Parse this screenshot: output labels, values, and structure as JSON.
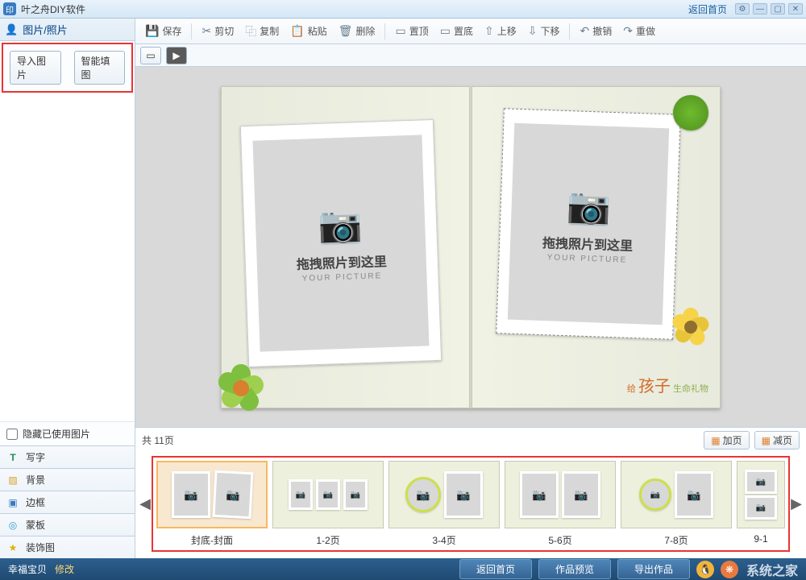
{
  "titlebar": {
    "title": "叶之舟DIY软件",
    "home_link": "返回首页"
  },
  "sidebar": {
    "header": "图片/照片",
    "import_btn": "导入图片",
    "smart_fill_btn": "智能填图",
    "hide_used_label": "隐藏已使用图片",
    "items": [
      {
        "label": "写字",
        "icon": "T",
        "color": "#1a8f5a"
      },
      {
        "label": "背景",
        "icon": "▨",
        "color": "#d9a22b"
      },
      {
        "label": "边框",
        "icon": "▣",
        "color": "#3a7ac0"
      },
      {
        "label": "蒙板",
        "icon": "◎",
        "color": "#2a9dcf"
      },
      {
        "label": "装饰图",
        "icon": "★",
        "color": "#e6b000"
      }
    ]
  },
  "toolbar": {
    "save": "保存",
    "cut": "剪切",
    "copy": "复制",
    "paste": "粘贴",
    "delete": "删除",
    "bring_front": "置顶",
    "send_back": "置底",
    "move_up": "上移",
    "move_down": "下移",
    "undo": "撤销",
    "redo": "重做"
  },
  "canvas": {
    "placeholder_zh": "拖拽照片到这里",
    "placeholder_en": "YOUR PICTURE",
    "ribbon_prefix": "给",
    "ribbon_main": "孩子",
    "ribbon_suffix": "生命礼物"
  },
  "thumbs": {
    "header": "共 11页",
    "add_page": "加页",
    "remove_page": "减页",
    "labels": [
      "封底-封面",
      "1-2页",
      "3-4页",
      "5-6页",
      "7-8页",
      "9-1"
    ]
  },
  "footer": {
    "project_name": "幸福宝贝",
    "modify": "修改",
    "home": "返回首页",
    "preview": "作品预览",
    "export": "导出作品",
    "watermark": "系统之家"
  }
}
